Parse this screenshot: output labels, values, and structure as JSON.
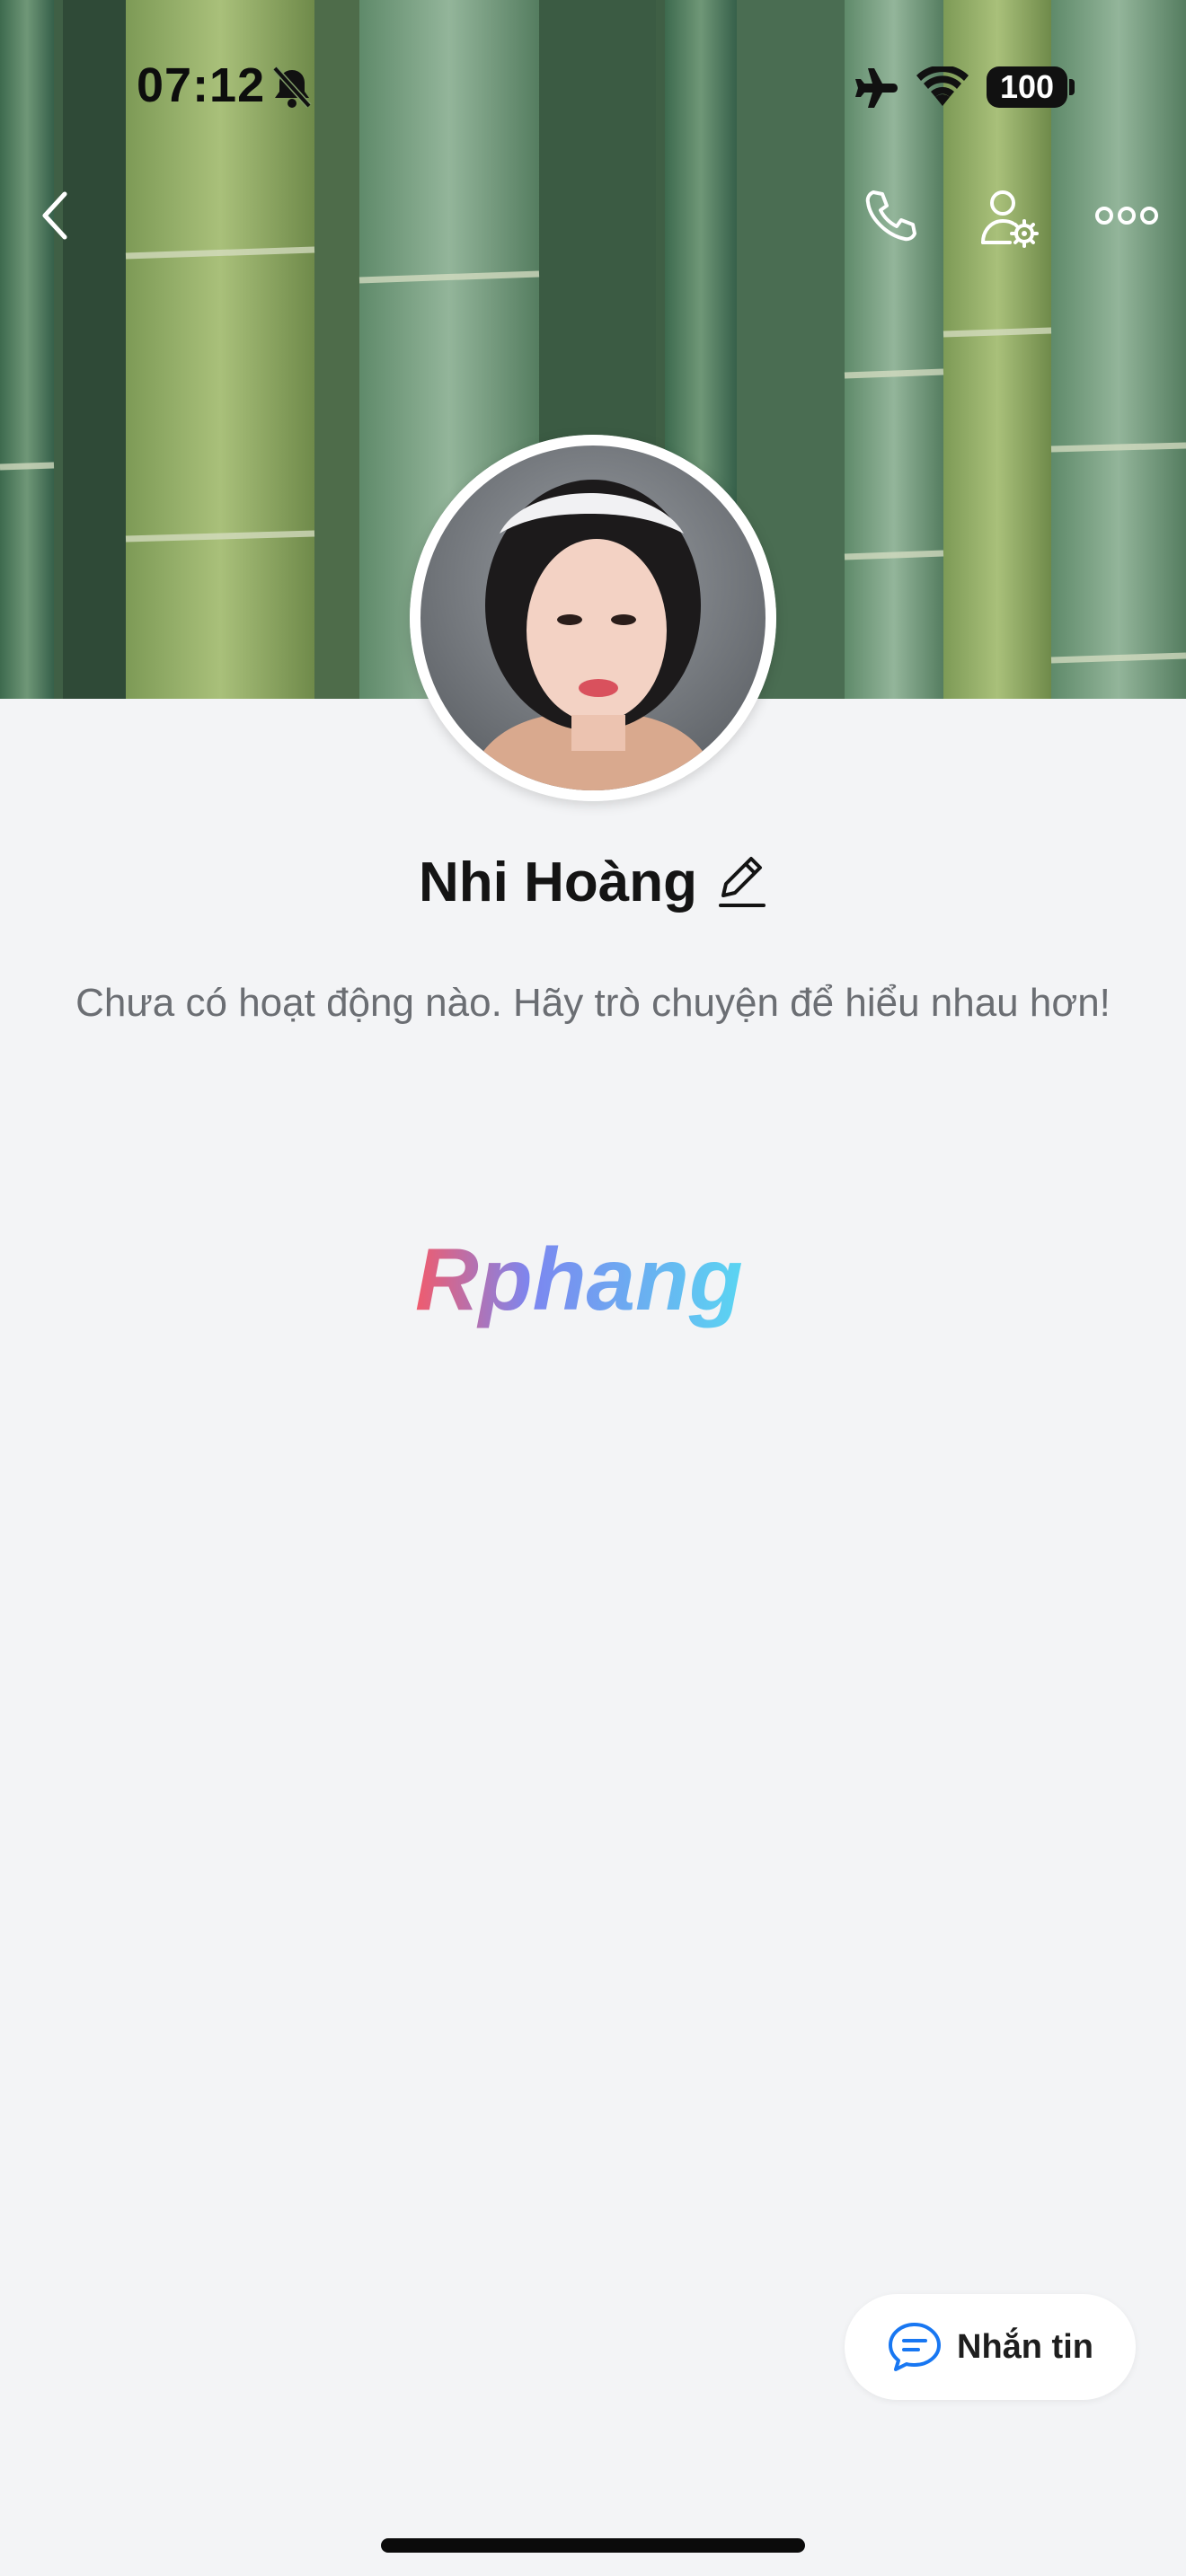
{
  "status_bar": {
    "time": "07:12",
    "battery": "100",
    "icons": [
      "bell-slash-icon",
      "airplane-icon",
      "wifi-icon",
      "battery-icon"
    ]
  },
  "nav": {
    "icons": [
      "back-chevron-icon",
      "phone-icon",
      "user-settings-icon",
      "more-dots-icon"
    ]
  },
  "profile": {
    "name": "Nhi Hoàng",
    "activity_text": "Chưa có hoạt động nào. Hãy trò chuyện để hiểu nhau hơn!"
  },
  "watermark": {
    "text": "Rphang"
  },
  "message_button": {
    "label": "Nhắn tin",
    "icon": "chat-bubble-icon",
    "icon_color": "#1877f2"
  }
}
